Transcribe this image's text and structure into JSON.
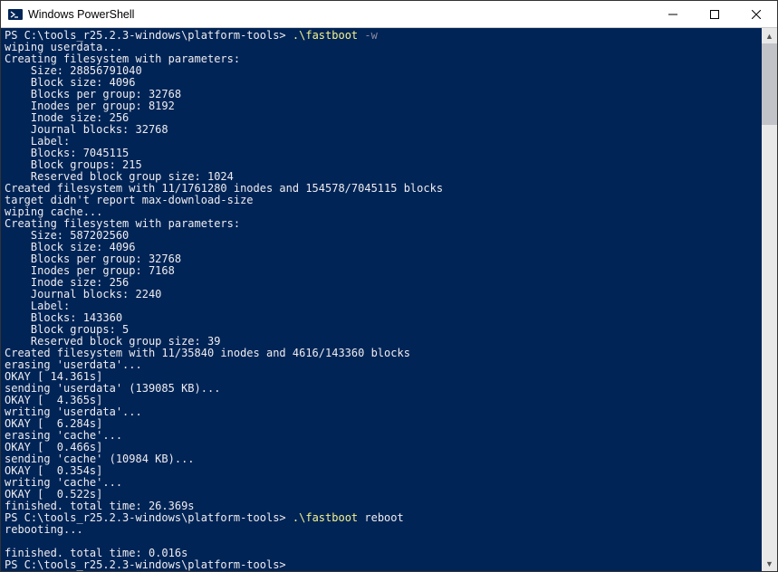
{
  "window": {
    "title": "Windows PowerShell"
  },
  "prompts": {
    "p1_pre": "PS C:\\tools_r25.2.3-windows\\platform-tools> ",
    "p1_cmd": ".\\fastboot",
    "p1_arg": " -w",
    "p2_pre": "PS C:\\tools_r25.2.3-windows\\platform-tools> ",
    "p2_cmd": ".\\fastboot",
    "p2_arg": " reboot",
    "p3": "PS C:\\tools_r25.2.3-windows\\platform-tools> "
  },
  "lines": {
    "l01": "wiping userdata...",
    "l02": "Creating filesystem with parameters:",
    "l03": "    Size: 28856791040",
    "l04": "    Block size: 4096",
    "l05": "    Blocks per group: 32768",
    "l06": "    Inodes per group: 8192",
    "l07": "    Inode size: 256",
    "l08": "    Journal blocks: 32768",
    "l09": "    Label:",
    "l10": "    Blocks: 7045115",
    "l11": "    Block groups: 215",
    "l12": "    Reserved block group size: 1024",
    "l13": "Created filesystem with 11/1761280 inodes and 154578/7045115 blocks",
    "l14": "target didn't report max-download-size",
    "l15": "wiping cache...",
    "l16": "Creating filesystem with parameters:",
    "l17": "    Size: 587202560",
    "l18": "    Block size: 4096",
    "l19": "    Blocks per group: 32768",
    "l20": "    Inodes per group: 7168",
    "l21": "    Inode size: 256",
    "l22": "    Journal blocks: 2240",
    "l23": "    Label:",
    "l24": "    Blocks: 143360",
    "l25": "    Block groups: 5",
    "l26": "    Reserved block group size: 39",
    "l27": "Created filesystem with 11/35840 inodes and 4616/143360 blocks",
    "l28": "erasing 'userdata'...",
    "l29": "OKAY [ 14.361s]",
    "l30": "sending 'userdata' (139085 KB)...",
    "l31": "OKAY [  4.365s]",
    "l32": "writing 'userdata'...",
    "l33": "OKAY [  6.284s]",
    "l34": "erasing 'cache'...",
    "l35": "OKAY [  0.466s]",
    "l36": "sending 'cache' (10984 KB)...",
    "l37": "OKAY [  0.354s]",
    "l38": "writing 'cache'...",
    "l39": "OKAY [  0.522s]",
    "l40": "finished. total time: 26.369s",
    "l41": "rebooting...",
    "l42": "",
    "l43": "finished. total time: 0.016s"
  }
}
